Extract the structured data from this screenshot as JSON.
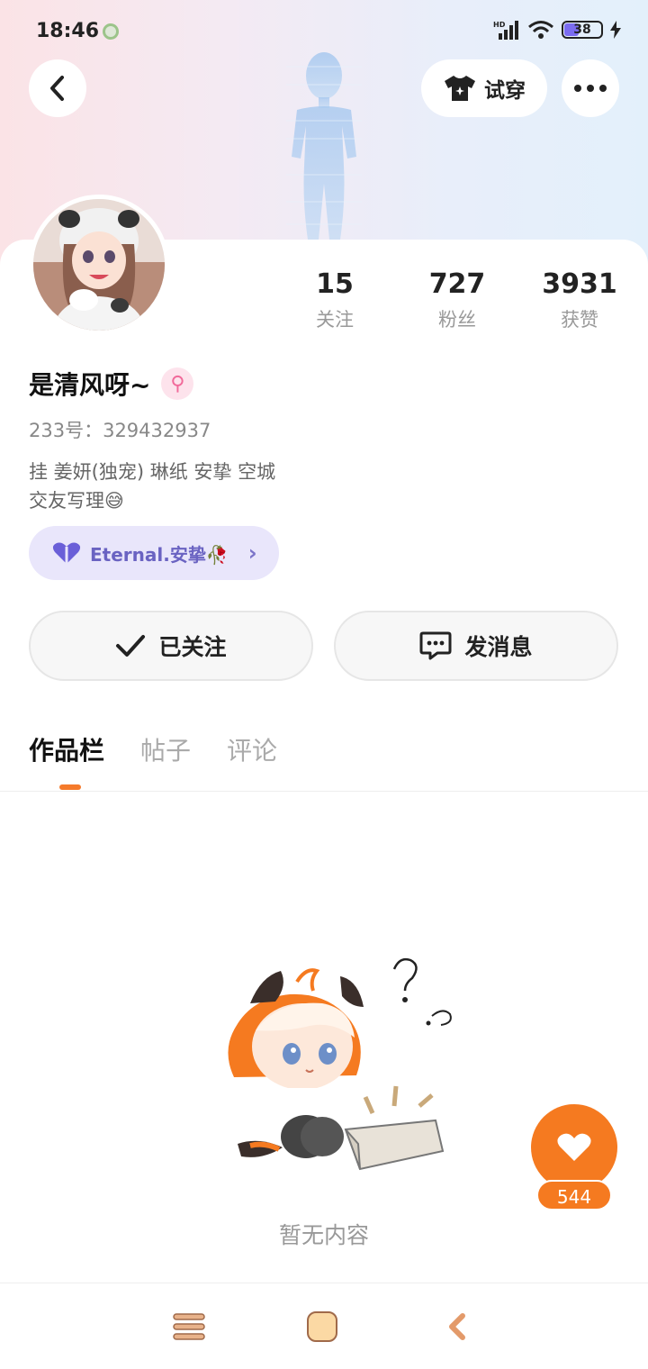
{
  "status_bar": {
    "time": "18:46",
    "battery": "38"
  },
  "header": {
    "try_on_label": "试穿"
  },
  "stats": [
    {
      "value": "15",
      "label": "关注"
    },
    {
      "value": "727",
      "label": "粉丝"
    },
    {
      "value": "3931",
      "label": "获赞"
    }
  ],
  "profile": {
    "username": "是清风呀~",
    "gender_symbol": "⚲",
    "uid": "233号：329432937",
    "bio_line1": "挂 姜妍(独宠) 琳纸   安挚   空城",
    "bio_line2": "交友写理😅",
    "tag_label": "Eternal.安挚🥀"
  },
  "actions": {
    "follow_label": "已关注",
    "message_label": "发消息"
  },
  "tabs": [
    {
      "label": "作品栏",
      "active": true
    },
    {
      "label": "帖子",
      "active": false
    },
    {
      "label": "评论",
      "active": false
    }
  ],
  "empty_state": {
    "text": "暂无内容"
  },
  "like": {
    "count": "544"
  },
  "colors": {
    "accent": "#f57a20",
    "tag_bg": "#e9e6fb",
    "tag_text": "#6a63c2"
  },
  "icons": [
    "back-icon",
    "tshirt-icon",
    "more-icon",
    "heart-icon",
    "check-icon",
    "chat-icon",
    "menu-icon",
    "home-icon",
    "nav-back-icon"
  ]
}
